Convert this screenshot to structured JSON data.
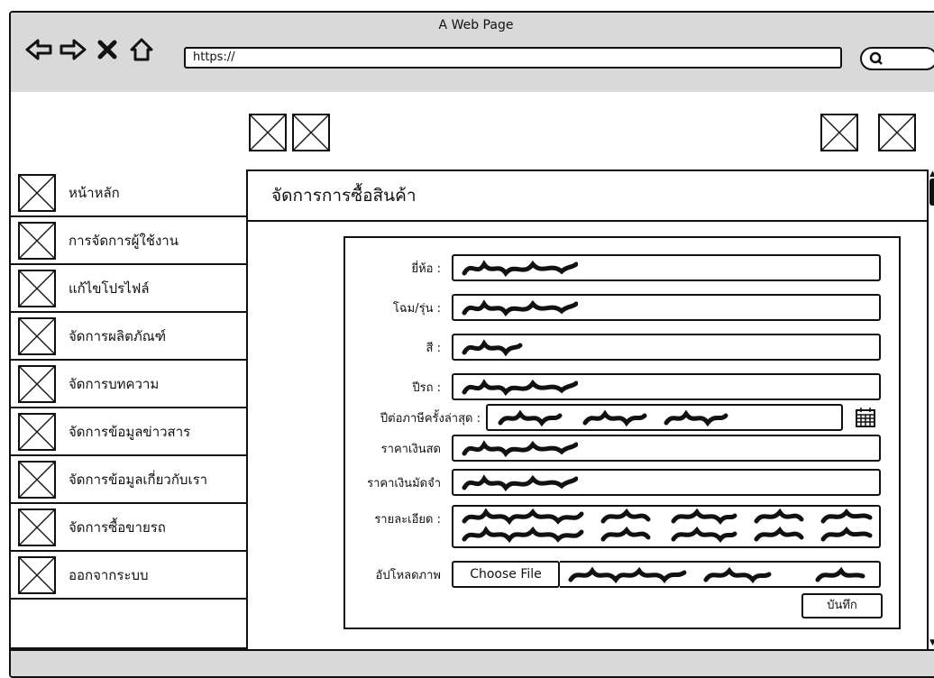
{
  "window": {
    "title": "A Web Page",
    "url": "https://"
  },
  "nav": [
    "back-icon",
    "forward-icon",
    "close-icon",
    "home-icon"
  ],
  "sidebar": {
    "items": [
      {
        "label": "หน้าหลัก"
      },
      {
        "label": "การจัดการผู้ใช้งาน"
      },
      {
        "label": "แก้ไขโปรไฟล์"
      },
      {
        "label": "จัดการผลิตภัณฑ์"
      },
      {
        "label": "จัดการบทความ"
      },
      {
        "label": "จัดการข้อมูลข่าวสาร"
      },
      {
        "label": "จัดการข้อมูลเกี่ยวกับเรา"
      },
      {
        "label": "จัดการซื้อขายรถ"
      },
      {
        "label": "ออกจากระบบ"
      }
    ]
  },
  "main": {
    "title": "จัดการการซื้อสินค้า",
    "form": {
      "brand_label": "ยี่ห้อ :",
      "model_label": "โฉม/รุ่น :",
      "color_label": "สี :",
      "year_label": "ปีรถ :",
      "tax_label": "ปีต่อภาษีครั้งล่าสุด :",
      "cash_label": "ราคาเงินสด",
      "deposit_label": "ราคาเงินมัดจำ",
      "detail_label": "รายละเอียด :",
      "upload_label": "อัปโหลดภาพ",
      "choose_file": "Choose File",
      "save_label": "บันทึก"
    }
  },
  "colors": {
    "chrome": "#d9d9d9",
    "stroke": "#111111"
  }
}
